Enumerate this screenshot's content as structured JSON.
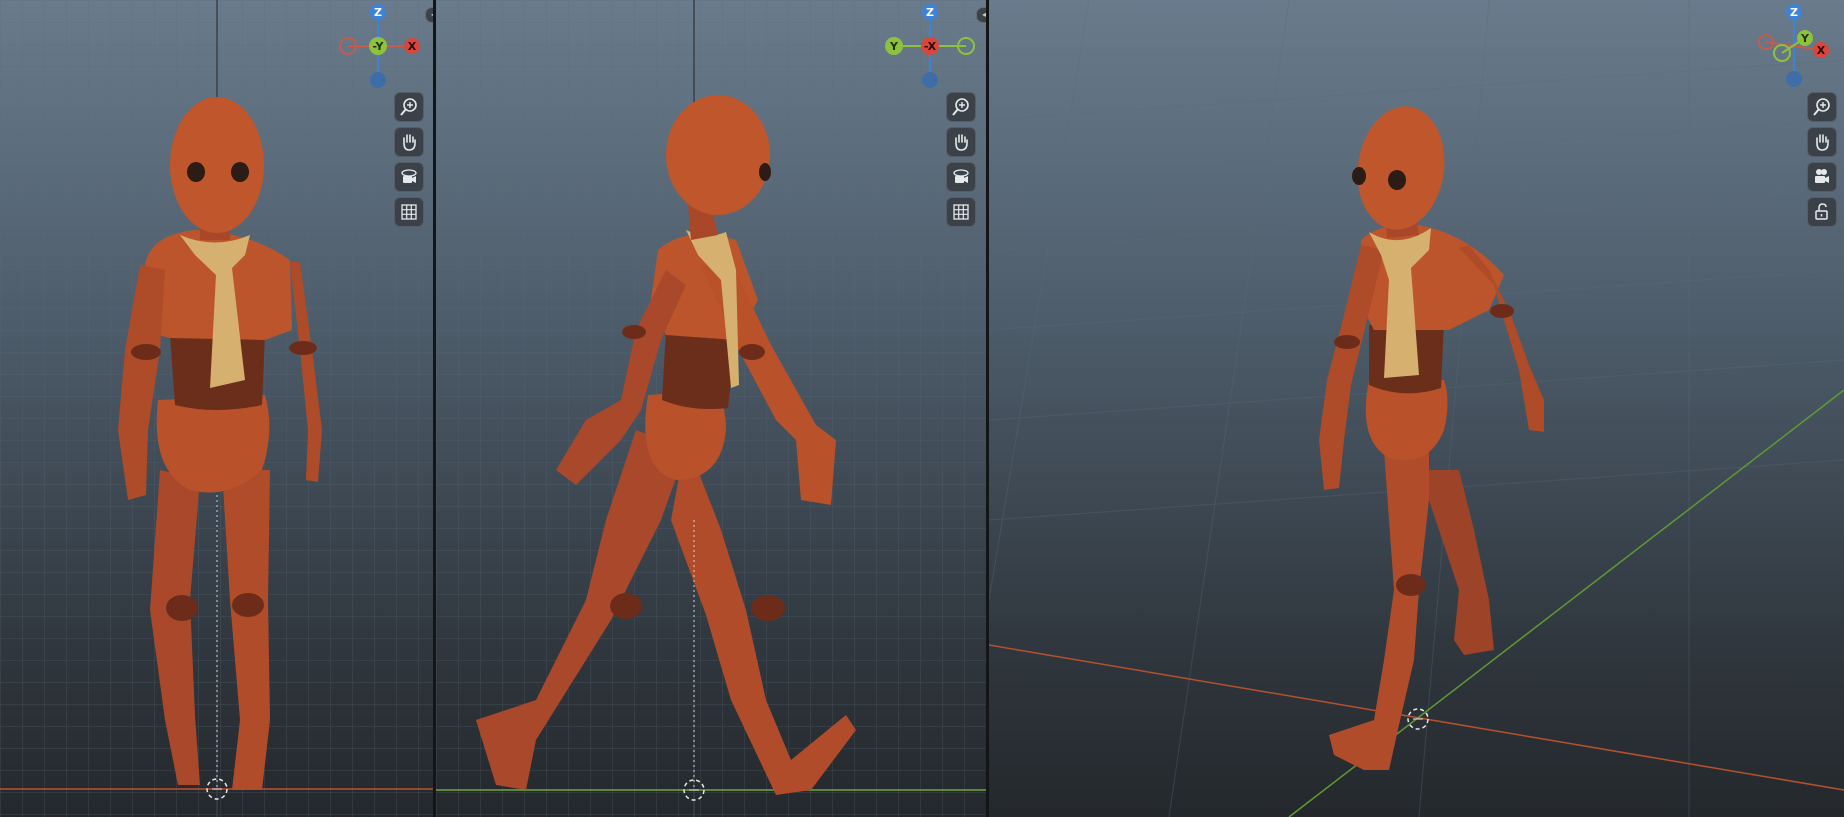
{
  "viewports": [
    {
      "id": "front",
      "gizmo": {
        "up": "Z",
        "left": "-Y",
        "right": "X",
        "center": "-Y",
        "left_label": "",
        "right_label": "X"
      },
      "tools": [
        "zoom-icon",
        "pan-hand-icon",
        "orbit-camera-icon",
        "grid-icon"
      ]
    },
    {
      "id": "side",
      "gizmo": {
        "up": "Z",
        "left": "Y",
        "center": "-X",
        "right": ""
      },
      "tools": [
        "zoom-icon",
        "pan-hand-icon",
        "orbit-camera-icon",
        "grid-icon"
      ]
    },
    {
      "id": "perspective",
      "gizmo": {
        "up": "Z",
        "center": "Y",
        "right": "X"
      },
      "tools": [
        "zoom-icon",
        "pan-hand-icon",
        "camera-icon",
        "lock-icon"
      ]
    }
  ],
  "colors": {
    "axis_x": "#d8463c",
    "axis_y": "#8cc23e",
    "axis_z": "#3d83d8",
    "body": "#b9512a",
    "scarf": "#d6b06e",
    "belt": "#6b2e1a",
    "grid_line": "#5d6d7b"
  }
}
